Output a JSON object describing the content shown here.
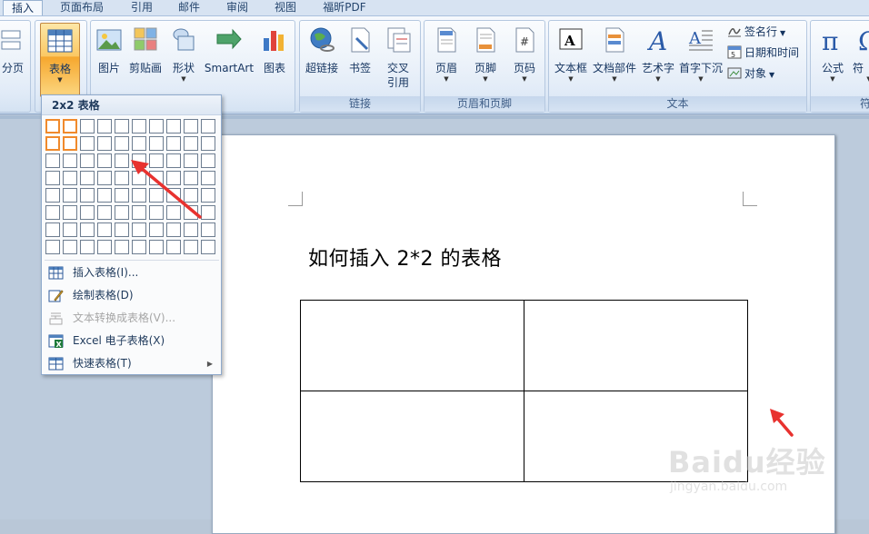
{
  "tabs": [
    "插入",
    "页面布局",
    "引用",
    "邮件",
    "审阅",
    "视图",
    "福昕PDF"
  ],
  "ribbon": {
    "pages_label": "分页",
    "table_label": "表格",
    "picture_label": "图片",
    "clipart_label": "剪贴画",
    "shapes_label": "形状",
    "smartart_label": "SmartArt",
    "chart_label": "图表",
    "hyperlink_label": "超链接",
    "bookmark_label": "书签",
    "crossref_label_1": "交叉",
    "crossref_label_2": "引用",
    "links_group": "链接",
    "header_label": "页眉",
    "footer_label": "页脚",
    "pagenum_label": "页码",
    "headerfooter_group": "页眉和页脚",
    "textbox_label": "文本框",
    "quickparts_label": "文档部件",
    "wordart_label": "艺术字",
    "dropcap_label": "首字下沉",
    "signature_label": "签名行",
    "datetime_label": "日期和时间",
    "object_label": "对象",
    "text_group": "文本",
    "equation_label": "公式",
    "symbol_label": "符",
    "symbols_group": "符"
  },
  "dropdown": {
    "header": "2x2 表格",
    "grid_cols": 10,
    "grid_rows": 8,
    "selected_cols": 2,
    "selected_rows": 2,
    "items": [
      {
        "label": "插入表格(I)..."
      },
      {
        "label": "绘制表格(D)"
      },
      {
        "label": "文本转换成表格(V)..."
      },
      {
        "label": "Excel 电子表格(X)"
      },
      {
        "label": "快速表格(T)"
      }
    ]
  },
  "document": {
    "heading": "如何插入 2*2 的表格"
  },
  "watermark": {
    "brand": "Baidu经验",
    "url": "jingyan.baidu.com"
  },
  "colors": {
    "selection": "#f08a2c",
    "annotation_arrow": "#e8322f"
  }
}
